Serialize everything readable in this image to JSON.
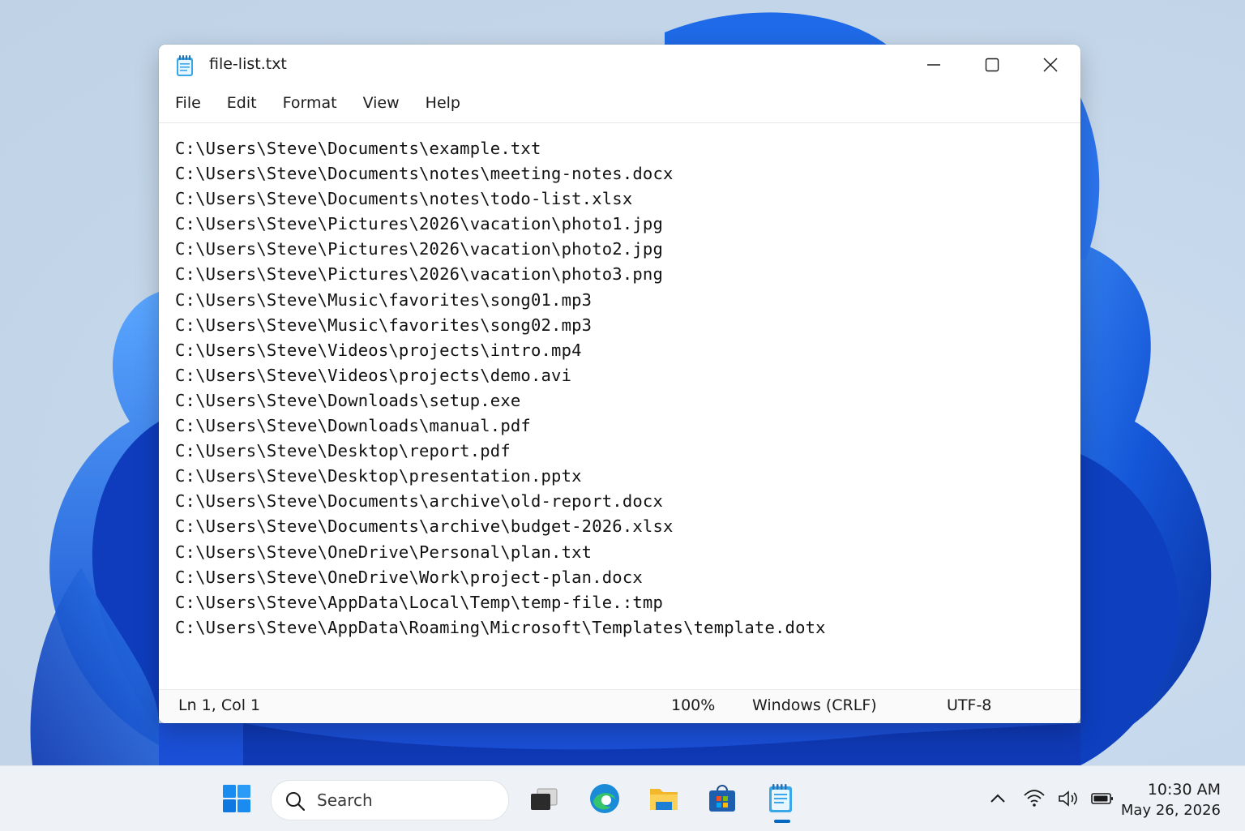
{
  "window": {
    "title": "file-list.txt",
    "menu": [
      "File",
      "Edit",
      "Format",
      "View",
      "Help"
    ],
    "controls": {
      "minimize": "minimize-icon",
      "maximize": "maximize-icon",
      "close": "close-icon"
    }
  },
  "editor": {
    "lines": [
      "C:\\Users\\Steve\\Documents\\example.txt",
      "C:\\Users\\Steve\\Documents\\notes\\meeting-notes.docx",
      "C:\\Users\\Steve\\Documents\\notes\\todo-list.xlsx",
      "C:\\Users\\Steve\\Pictures\\2026\\vacation\\photo1.jpg",
      "C:\\Users\\Steve\\Pictures\\2026\\vacation\\photo2.jpg",
      "C:\\Users\\Steve\\Pictures\\2026\\vacation\\photo3.png",
      "C:\\Users\\Steve\\Music\\favorites\\song01.mp3",
      "C:\\Users\\Steve\\Music\\favorites\\song02.mp3",
      "C:\\Users\\Steve\\Videos\\projects\\intro.mp4",
      "C:\\Users\\Steve\\Videos\\projects\\demo.avi",
      "C:\\Users\\Steve\\Downloads\\setup.exe",
      "C:\\Users\\Steve\\Downloads\\manual.pdf",
      "C:\\Users\\Steve\\Desktop\\report.pdf",
      "C:\\Users\\Steve\\Desktop\\presentation.pptx",
      "C:\\Users\\Steve\\Documents\\archive\\old-report.docx",
      "C:\\Users\\Steve\\Documents\\archive\\budget-2026.xlsx",
      "C:\\Users\\Steve\\OneDrive\\Personal\\plan.txt",
      "C:\\Users\\Steve\\OneDrive\\Work\\project-plan.docx",
      "C:\\Users\\Steve\\AppData\\Local\\Temp\\temp-file.:tmp",
      "C:\\Users\\Steve\\AppData\\Roaming\\Microsoft\\Templates\\template.dotx"
    ]
  },
  "status": {
    "position": "Ln 1, Col 1",
    "zoom": "100%",
    "line_ending": "Windows (CRLF)",
    "encoding": "UTF-8"
  },
  "taskbar": {
    "search_label": "Search",
    "apps": [
      "start-icon",
      "task-view-icon",
      "edge-icon",
      "file-explorer-icon",
      "store-icon",
      "notepad-icon"
    ],
    "tray": [
      "chevron-up-icon",
      "wifi-icon",
      "volume-icon",
      "battery-icon"
    ],
    "time": "10:30 AM",
    "date": "May 26, 2026"
  },
  "colors": {
    "accent": "#0067c0",
    "wallpaper_blue": "#1a5fe0"
  }
}
